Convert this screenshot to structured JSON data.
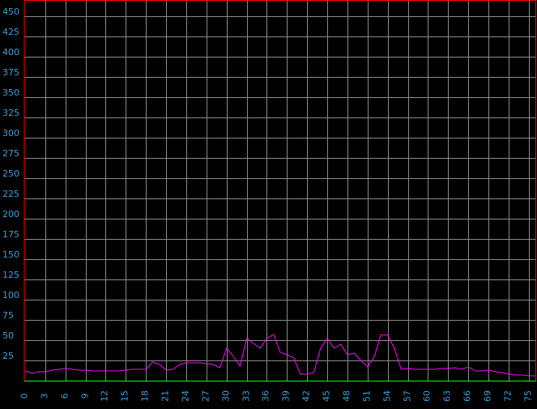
{
  "chart_data": {
    "type": "line",
    "title": "",
    "xlabel": "",
    "ylabel": "",
    "xlim": [
      0,
      76
    ],
    "ylim": [
      0,
      470
    ],
    "grid": true,
    "x_ticks": [
      "0",
      "3",
      "6",
      "9",
      "12",
      "15",
      "18",
      "21",
      "24",
      "27",
      "30",
      "33",
      "36",
      "39",
      "42",
      "45",
      "48",
      "51",
      "54",
      "57",
      "60",
      "63",
      "66",
      "69",
      "72",
      "75"
    ],
    "y_ticks": [
      "25",
      "50",
      "75",
      "100",
      "125",
      "150",
      "175",
      "200",
      "225",
      "250",
      "275",
      "300",
      "325",
      "350",
      "375",
      "400",
      "425",
      "450"
    ],
    "series": [
      {
        "color": "#ff00ff",
        "x": [
          0,
          1,
          2,
          3,
          4,
          5,
          6,
          7,
          8,
          9,
          10,
          11,
          12,
          13,
          14,
          15,
          16,
          17,
          18,
          19,
          20,
          21,
          22,
          23,
          24,
          25,
          26,
          27,
          28,
          29,
          30,
          31,
          32,
          33,
          34,
          35,
          36,
          37,
          38,
          39,
          40,
          41,
          42,
          43,
          44,
          45,
          46,
          47,
          48,
          49,
          50,
          51,
          52,
          53,
          54,
          55,
          56,
          57,
          58,
          59,
          60,
          61,
          62,
          63,
          64,
          65,
          66,
          67,
          68,
          69,
          70,
          71,
          72,
          73,
          74,
          75,
          76
        ],
        "y": [
          12,
          9,
          11,
          11,
          13,
          14,
          15,
          14,
          13,
          13,
          12,
          12,
          12,
          12,
          12,
          13,
          14,
          14,
          14,
          23,
          20,
          13,
          14,
          20,
          22,
          22,
          22,
          21,
          20,
          16,
          40,
          30,
          18,
          52,
          46,
          40,
          52,
          57,
          35,
          32,
          28,
          8,
          8,
          10,
          40,
          52,
          40,
          45,
          32,
          34,
          25,
          17,
          30,
          57,
          56,
          40,
          14,
          15,
          14,
          14,
          14,
          14,
          15,
          15,
          16,
          14,
          17,
          12,
          12,
          13,
          11,
          10,
          8,
          7,
          7,
          6,
          6
        ]
      }
    ],
    "baseline": {
      "value": 0,
      "color": "#00ff00"
    },
    "frame_color": "#ff0000"
  }
}
